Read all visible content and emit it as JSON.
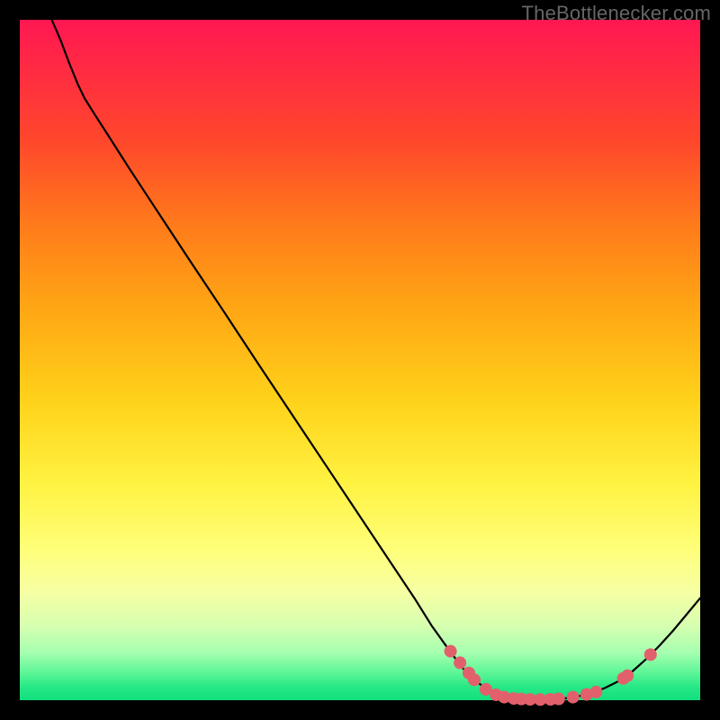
{
  "watermark": "TheBottlenecker.com",
  "chart_data": {
    "type": "line",
    "title": "",
    "xlabel": "",
    "ylabel": "",
    "xlim": [
      0,
      100
    ],
    "ylim": [
      0,
      100
    ],
    "curve_norm": [
      [
        4.7,
        100.0
      ],
      [
        6.0,
        97.0
      ],
      [
        7.2,
        93.8
      ],
      [
        8.5,
        90.6
      ],
      [
        9.5,
        88.5
      ],
      [
        11.0,
        86.1
      ],
      [
        13.0,
        83.0
      ],
      [
        16.0,
        78.3
      ],
      [
        20.0,
        72.2
      ],
      [
        25.0,
        64.6
      ],
      [
        30.0,
        57.1
      ],
      [
        35.0,
        49.5
      ],
      [
        40.0,
        42.0
      ],
      [
        45.0,
        34.5
      ],
      [
        50.0,
        27.0
      ],
      [
        55.0,
        19.5
      ],
      [
        58.0,
        15.0
      ],
      [
        60.5,
        11.0
      ],
      [
        63.0,
        7.5
      ],
      [
        65.0,
        4.8
      ],
      [
        67.0,
        2.8
      ],
      [
        69.0,
        1.4
      ],
      [
        71.0,
        0.6
      ],
      [
        73.0,
        0.25
      ],
      [
        75.5,
        0.1
      ],
      [
        78.0,
        0.1
      ],
      [
        80.0,
        0.25
      ],
      [
        82.0,
        0.55
      ],
      [
        84.0,
        1.0
      ],
      [
        86.0,
        1.8
      ],
      [
        88.0,
        2.8
      ],
      [
        90.0,
        4.2
      ],
      [
        92.0,
        6.0
      ],
      [
        94.0,
        8.0
      ],
      [
        96.0,
        10.2
      ],
      [
        98.0,
        12.6
      ],
      [
        100.0,
        15.0
      ]
    ],
    "dots_norm": [
      [
        63.3,
        7.2
      ],
      [
        64.7,
        5.5
      ],
      [
        66.0,
        4.0
      ],
      [
        66.8,
        3.0
      ],
      [
        68.5,
        1.6
      ],
      [
        70.0,
        0.8
      ],
      [
        71.2,
        0.45
      ],
      [
        72.6,
        0.25
      ],
      [
        73.7,
        0.18
      ],
      [
        75.0,
        0.12
      ],
      [
        76.5,
        0.1
      ],
      [
        78.0,
        0.13
      ],
      [
        79.2,
        0.2
      ],
      [
        81.3,
        0.45
      ],
      [
        83.3,
        0.85
      ],
      [
        84.7,
        1.2
      ],
      [
        88.7,
        3.2
      ],
      [
        89.3,
        3.6
      ],
      [
        92.7,
        6.7
      ]
    ],
    "dot_color": "#e2606b",
    "line_color": "#000000"
  }
}
